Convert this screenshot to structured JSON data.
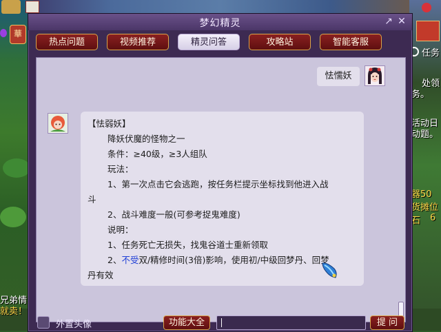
{
  "window": {
    "title": "梦幻精灵",
    "pin_icon": "pin-icon",
    "close_icon": "close-icon"
  },
  "tabs": [
    {
      "label": "热点问题",
      "active": false
    },
    {
      "label": "视频推荐",
      "active": false
    },
    {
      "label": "精灵问答",
      "active": true
    },
    {
      "label": "攻略站",
      "active": false
    },
    {
      "label": "智能客服",
      "active": false
    }
  ],
  "chat": {
    "user_message": "怯懦妖",
    "bot_lines": [
      "【怯弱妖】",
      "降妖伏魔的怪物之一",
      "条件：≥40级，≥3人组队",
      "玩法：",
      "1、第一次点击它会逃跑，按任务栏提示坐标找到他进入战",
      "斗",
      "2、战斗难度一般(可参考捉鬼难度)",
      "说明：",
      "1、任务死亡无损失，找鬼谷道士重新领取",
      "2、",
      "不受",
      "双/精修时间(3倍)影响，使用初/中级回梦丹、回梦",
      "丹有效"
    ]
  },
  "bottom": {
    "checkbox_label": "外置头像",
    "function_button": "功能大全",
    "input_value": "",
    "ask_button": "提 问"
  },
  "background": {
    "left_snippets": [
      "兄弟情",
      "就卖！"
    ],
    "right_snippets": [
      "任务",
      "处领",
      "务。",
      "活动日",
      "动题。",
      "器50",
      "货摊位",
      "石",
      "6"
    ],
    "top_badge": "華"
  },
  "colors": {
    "window_bg": "#3d2a52",
    "chat_bg": "#cbc5dc",
    "bubble_bg": "#e3dfec",
    "tab_red": "#8a2020",
    "tab_active": "#f4f0fa",
    "highlight_blue": "#1f3fd6"
  }
}
